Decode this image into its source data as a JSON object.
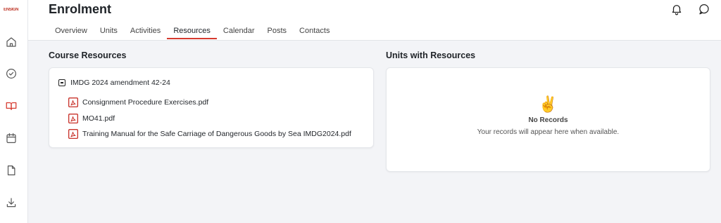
{
  "sidebar": {
    "logo_text": "ENSIGN",
    "items": [
      {
        "icon": "home-icon"
      },
      {
        "icon": "check-circle-icon"
      },
      {
        "icon": "book-open-icon"
      },
      {
        "icon": "calendar-icon"
      },
      {
        "icon": "document-icon"
      },
      {
        "icon": "download-icon"
      }
    ],
    "active_color": "#d63a2f"
  },
  "header": {
    "title": "Enrolment",
    "tabs": [
      {
        "label": "Overview"
      },
      {
        "label": "Units"
      },
      {
        "label": "Activities"
      },
      {
        "label": "Resources",
        "active": true
      },
      {
        "label": "Calendar"
      },
      {
        "label": "Posts"
      },
      {
        "label": "Contacts"
      }
    ],
    "icons": [
      "bell-icon",
      "chat-icon"
    ]
  },
  "course_resources": {
    "title": "Course Resources",
    "folder": "IMDG 2024 amendment 42-24",
    "files": [
      {
        "name": "Consignment Procedure Exercises.pdf",
        "icon": "pdf-icon"
      },
      {
        "name": "MO41.pdf",
        "icon": "pdf-icon"
      },
      {
        "name": "Training Manual for the Safe Carriage of Dangerous Goods by Sea IMDG2024.pdf",
        "icon": "pdf-icon"
      }
    ]
  },
  "units_resources": {
    "title": "Units with Resources",
    "empty_icon": "✌️",
    "empty_title": "No Records",
    "empty_subtitle": "Your records will appear here when available."
  }
}
